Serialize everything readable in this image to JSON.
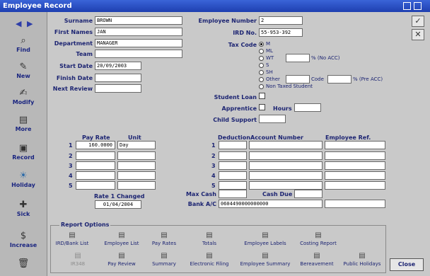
{
  "window": {
    "title": "Employee Record"
  },
  "sidebar": {
    "items": [
      {
        "label": "Find",
        "icon": "find-icon"
      },
      {
        "label": "New",
        "icon": "new-icon"
      },
      {
        "label": "Modify",
        "icon": "modify-icon"
      },
      {
        "label": "More",
        "icon": "more-icon"
      },
      {
        "label": "Record",
        "icon": "record-icon"
      },
      {
        "label": "Holiday",
        "icon": "holiday-icon"
      },
      {
        "label": "Sick",
        "icon": "sick-icon"
      },
      {
        "label": "Increase",
        "icon": "increase-icon"
      }
    ]
  },
  "employee": {
    "surname_label": "Surname",
    "surname": "BROWN",
    "first_names_label": "First Names",
    "first_names": "JAN",
    "department_label": "Department",
    "department": "MANAGER",
    "team_label": "Team",
    "team": "",
    "start_date_label": "Start Date",
    "start_date": "20/09/2003",
    "finish_date_label": "Finish Date",
    "finish_date": "",
    "next_review_label": "Next Review",
    "next_review": "",
    "employee_number_label": "Employee Number",
    "employee_number": "2",
    "ird_label": "IRD No.",
    "ird": "55-953-392"
  },
  "tax": {
    "label": "Tax Code",
    "codes": [
      "M",
      "ML",
      "WT",
      "S",
      "SH",
      "Other",
      "Non Taxed Student"
    ],
    "selected": "M",
    "wt_pct_label": "% (No ACC)",
    "other_code_label": "Code",
    "other_pct_label": "% (Pre ACC)"
  },
  "flags": {
    "student_loan_label": "Student Loan",
    "apprentice_label": "Apprentice",
    "hours_label": "Hours",
    "hours": "",
    "child_support_label": "Child Support",
    "child_support": ""
  },
  "pay": {
    "pay_rate_header": "Pay Rate",
    "unit_header": "Unit",
    "rows": [
      {
        "n": "1",
        "rate": "160.0000",
        "unit": "Day"
      },
      {
        "n": "2",
        "rate": "",
        "unit": ""
      },
      {
        "n": "3",
        "rate": "",
        "unit": ""
      },
      {
        "n": "4",
        "rate": "",
        "unit": ""
      },
      {
        "n": "5",
        "rate": "",
        "unit": ""
      }
    ],
    "rate_changed_label": "Rate 1 Changed",
    "rate_changed": "01/04/2004"
  },
  "deductions": {
    "deduction_header": "Deduction",
    "account_header": "Account Number",
    "ref_header": "Employee Ref.",
    "rows": [
      {
        "n": "1"
      },
      {
        "n": "2"
      },
      {
        "n": "3"
      },
      {
        "n": "4"
      },
      {
        "n": "5"
      }
    ],
    "max_cash_label": "Max Cash",
    "max_cash": "",
    "cash_due_label": "Cash Due",
    "cash_due": "",
    "bank_label": "Bank A/C",
    "bank": "0604490000000000",
    "bank_ref": ""
  },
  "report_options": {
    "title": "Report Options",
    "items": [
      {
        "label": "IRD/Bank List",
        "disabled": false
      },
      {
        "label": "Employee List",
        "disabled": false
      },
      {
        "label": "Pay Rates",
        "disabled": false
      },
      {
        "label": "Totals",
        "disabled": false
      },
      {
        "label": "Employee Labels",
        "disabled": false
      },
      {
        "label": "Costing Report",
        "disabled": false
      },
      {
        "label": "IR348",
        "disabled": true
      },
      {
        "label": "Pay Review",
        "disabled": false
      },
      {
        "label": "Summary",
        "disabled": false
      },
      {
        "label": "Electronic Filing",
        "disabled": false
      },
      {
        "label": "Employee Summary",
        "disabled": false
      },
      {
        "label": "Bereavement",
        "disabled": false
      },
      {
        "label": "Public Holidays",
        "disabled": false
      }
    ]
  },
  "buttons": {
    "close": "Close",
    "accept_icon": "checkmark-icon",
    "cancel_icon": "cancel-icon"
  }
}
